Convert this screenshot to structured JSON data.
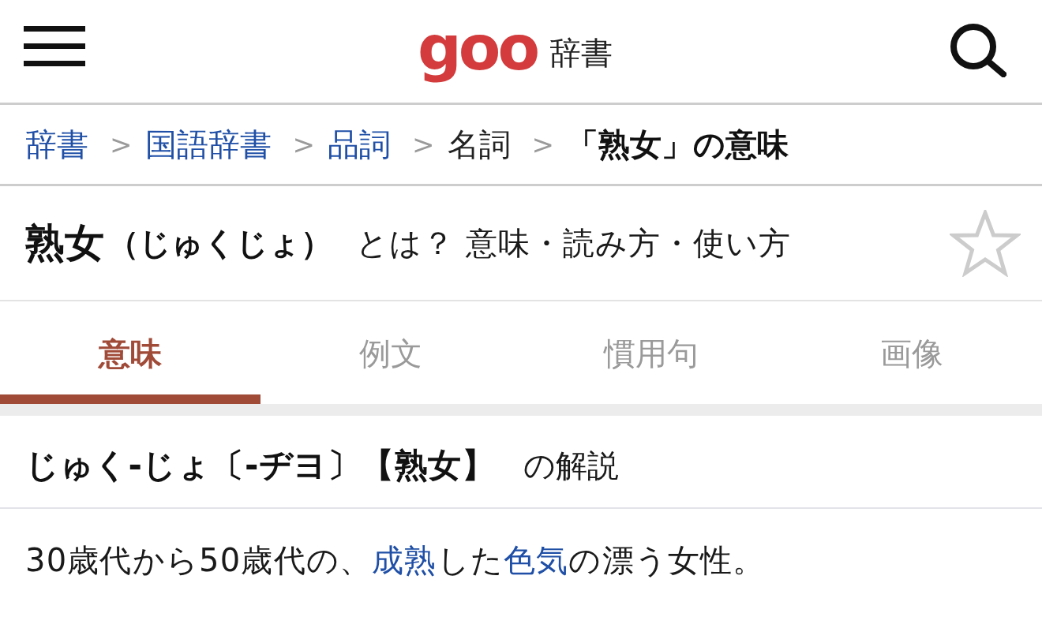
{
  "header": {
    "logo": "goo",
    "title": "辞書"
  },
  "breadcrumb": [
    {
      "kind": "link",
      "label": "辞書"
    },
    {
      "kind": "separator",
      "label": ">"
    },
    {
      "kind": "link",
      "label": "国語辞書"
    },
    {
      "kind": "separator",
      "label": ">"
    },
    {
      "kind": "link",
      "label": "品詞"
    },
    {
      "kind": "separator",
      "label": ">"
    },
    {
      "kind": "text",
      "label": "名詞"
    },
    {
      "kind": "separator",
      "label": ">"
    },
    {
      "kind": "current",
      "label": "「熟女」の意味"
    }
  ],
  "word_title": {
    "word": "熟女",
    "reading": "（じゅくじょ）",
    "subtitle": "とは？ 意味・読み方・使い方",
    "bookmarked": false
  },
  "tabs": [
    {
      "label": "意味",
      "selected": true
    },
    {
      "label": "例文",
      "selected": false
    },
    {
      "label": "慣用句",
      "selected": false
    },
    {
      "label": "画像",
      "selected": false
    }
  ],
  "entry": {
    "heading": "じゅく-じょ〔-ヂヨ〕【熟女】",
    "heading_note": "の解説",
    "definition": [
      {
        "kind": "text",
        "text": "30歳代から50歳代の、"
      },
      {
        "kind": "link",
        "text": "成熟"
      },
      {
        "kind": "text",
        "text": "した"
      },
      {
        "kind": "link",
        "text": "色気"
      },
      {
        "kind": "text",
        "text": "の漂う女性。"
      }
    ]
  }
}
